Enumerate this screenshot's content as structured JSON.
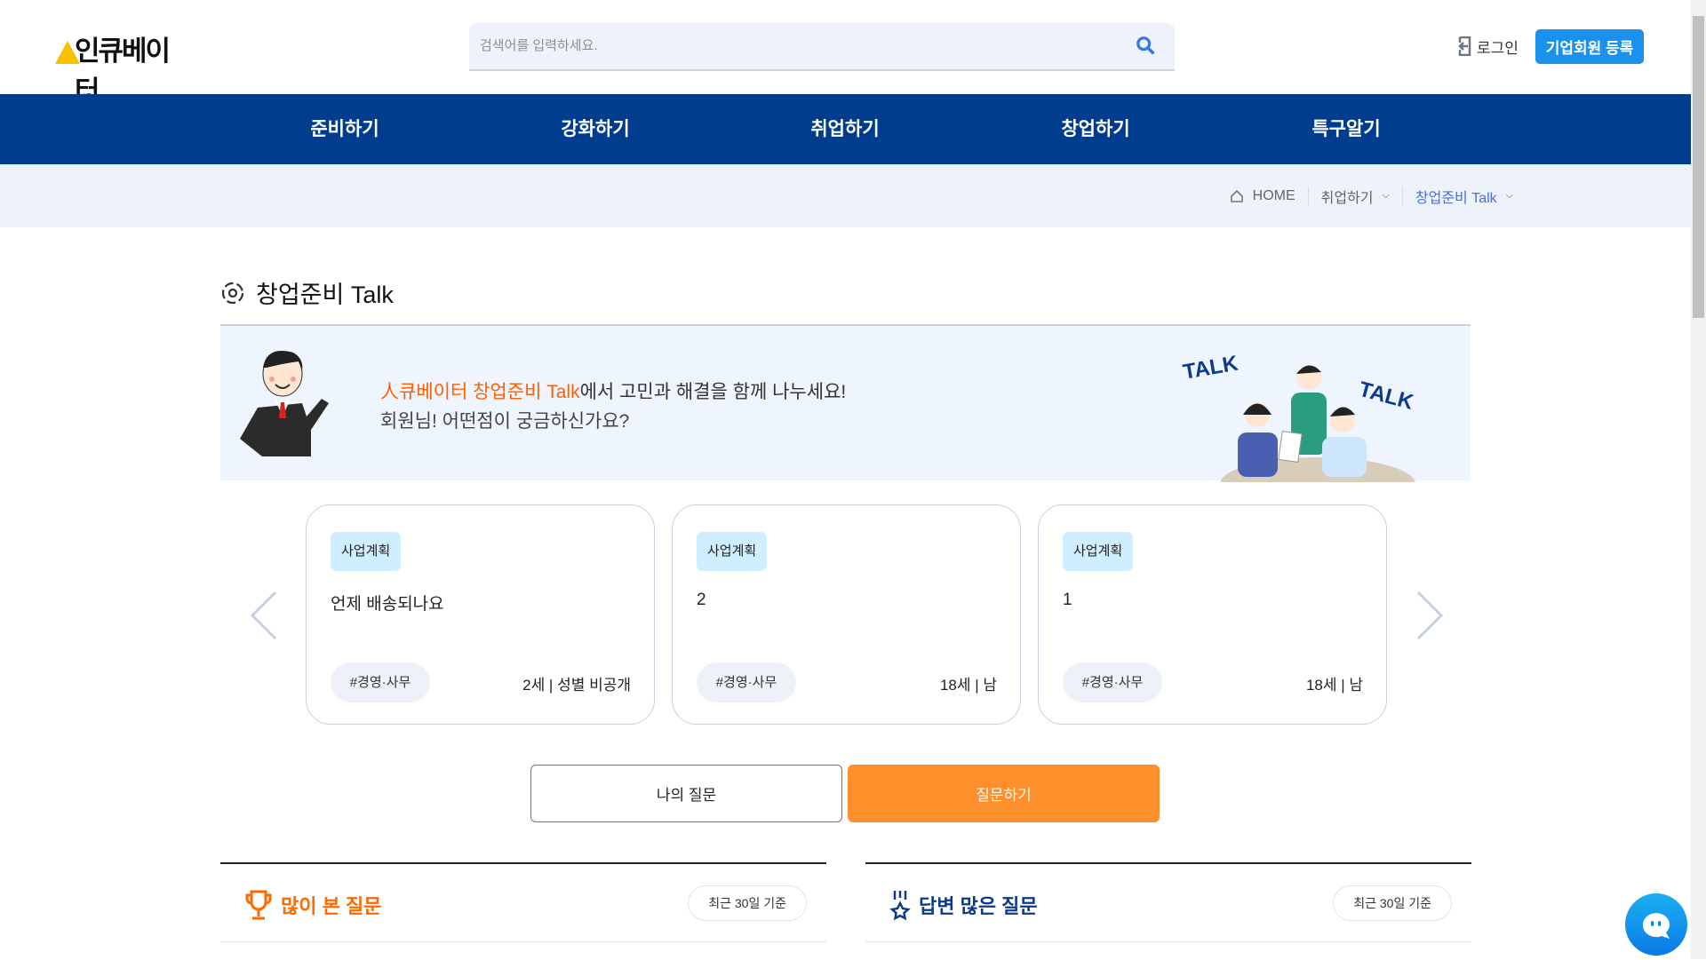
{
  "header": {
    "logo_text": "인큐베이터",
    "search_placeholder": "검색어를 입력하세요.",
    "login_label": "로그인",
    "corp_register_label": "기업회원 등록"
  },
  "nav": {
    "items": [
      {
        "label": "준비하기"
      },
      {
        "label": "강화하기"
      },
      {
        "label": "취업하기"
      },
      {
        "label": "창업하기"
      },
      {
        "label": "특구알기"
      }
    ]
  },
  "breadcrumb": {
    "home": "HOME",
    "level1": "취업하기",
    "level2": "창업준비 Talk"
  },
  "page": {
    "title": "창업준비 Talk"
  },
  "banner": {
    "highlight": "人큐베이터 창업준비 Talk",
    "line1_rest": "에서 고민과 해결을 함께 나누세요!",
    "line2": "회원님! 어떤점이 궁금하신가요?",
    "illustration_text_1": "TALK",
    "illustration_text_2": "TALK"
  },
  "cards": [
    {
      "tag": "사업계획",
      "question": "언제 배송되나요",
      "hashtag": "#경영·사무",
      "meta": "2세 | 성별 비공개"
    },
    {
      "tag": "사업계획",
      "question": "2",
      "hashtag": "#경영·사무",
      "meta": "18세 | 남"
    },
    {
      "tag": "사업계획",
      "question": "1",
      "hashtag": "#경영·사무",
      "meta": "18세 | 남"
    }
  ],
  "actions": {
    "my_questions": "나의 질문",
    "ask": "질문하기"
  },
  "sections": [
    {
      "title": "많이 본 질문",
      "filter": "최근 30일 기준",
      "color": "#ff6a00"
    },
    {
      "title": "답변 많은 질문",
      "filter": "최근 30일 기준",
      "color": "#0d3a8a"
    }
  ],
  "colors": {
    "nav_bg": "#003d8f",
    "accent_orange": "#ff8f2a",
    "primary_blue": "#1a91ec",
    "breadcrumb_active": "#4a6ee0"
  }
}
